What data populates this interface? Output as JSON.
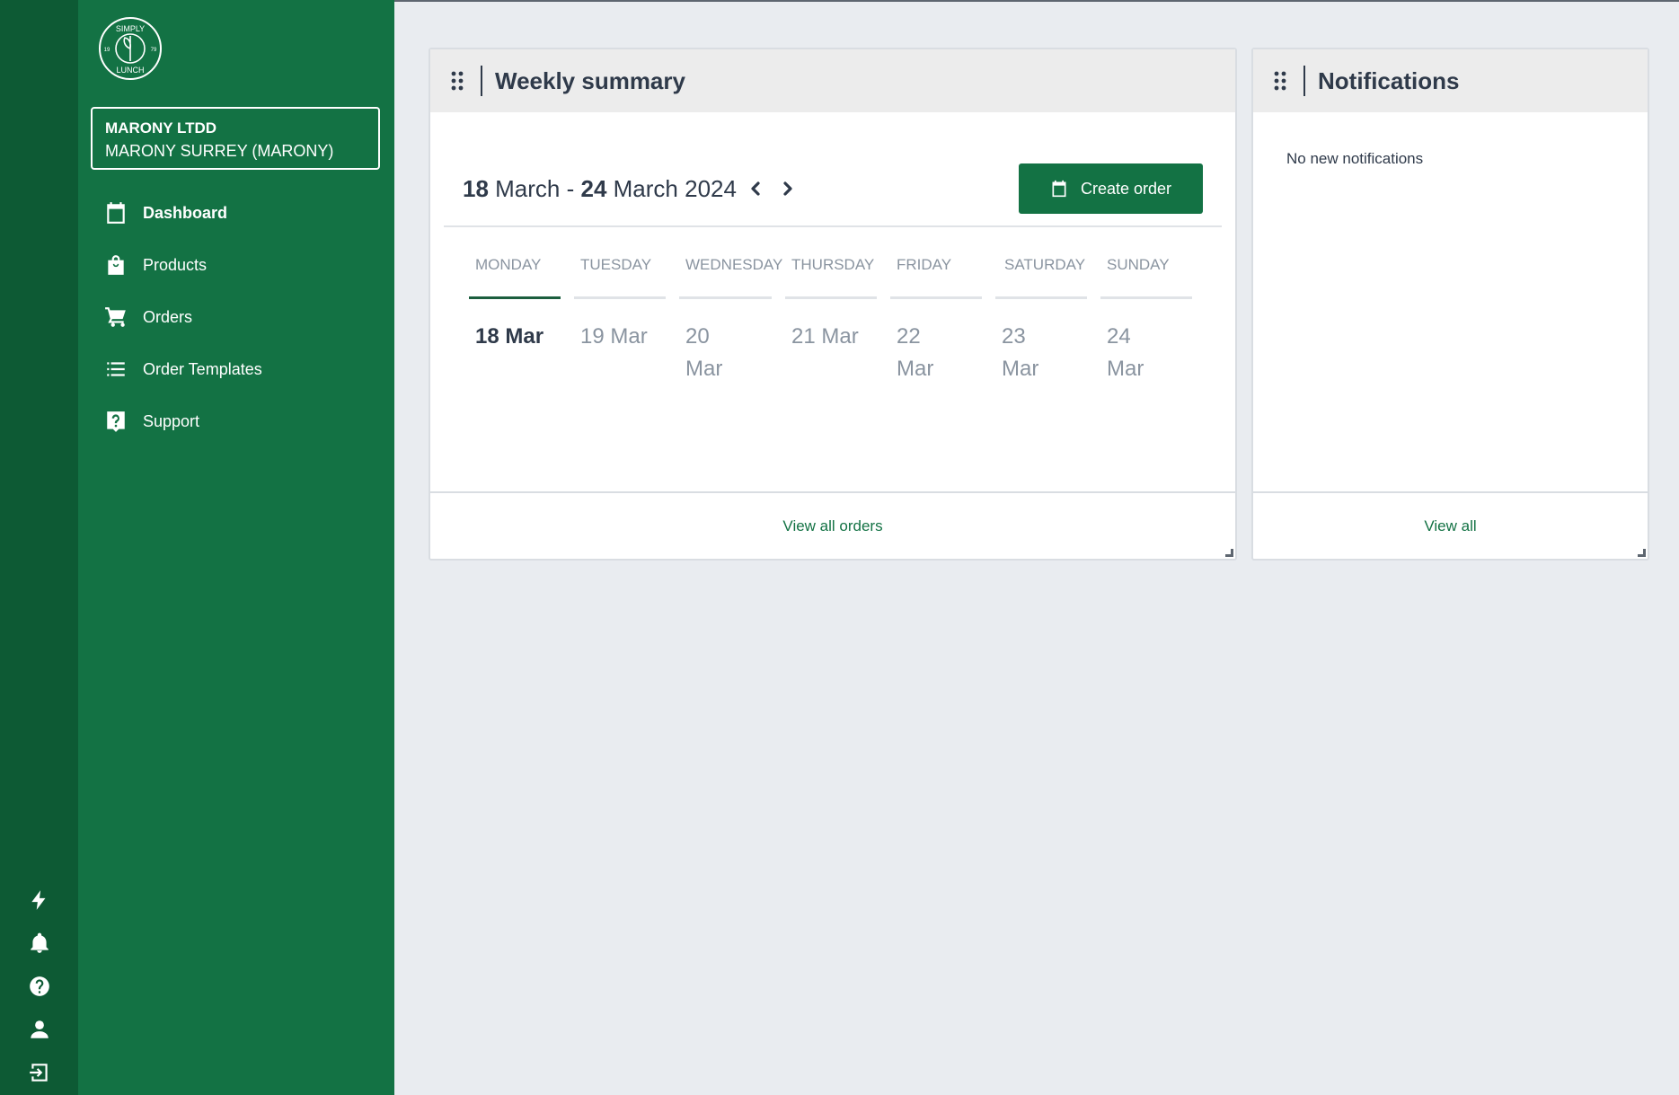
{
  "brand": {
    "logo_lines": [
      "SIMPLY",
      "LUNCH"
    ],
    "logo_year_left": "19",
    "logo_year_right": "79",
    "primary_color": "#137244",
    "rail_color": "#0d5a34"
  },
  "account": {
    "name": "MARONY LTDD",
    "site": "MARONY SURREY (MARONY)"
  },
  "nav": [
    {
      "label": "Dashboard",
      "icon": "calendar-icon",
      "active": true
    },
    {
      "label": "Products",
      "icon": "shopping-bag-icon",
      "active": false
    },
    {
      "label": "Orders",
      "icon": "cart-icon",
      "active": false
    },
    {
      "label": "Order Templates",
      "icon": "list-icon",
      "active": false
    },
    {
      "label": "Support",
      "icon": "help-chat-icon",
      "active": false
    }
  ],
  "rail_icons": [
    "lightning-icon",
    "bell-icon",
    "help-circle-icon",
    "user-icon",
    "logout-icon"
  ],
  "weekly": {
    "title": "Weekly summary",
    "range_start_day": "18",
    "range_start_rest": " March - ",
    "range_end_day": "24",
    "range_end_rest": " March 2024",
    "create_label": "Create order",
    "footer_link": "View all orders",
    "days": [
      {
        "name": "MONDAY",
        "date": "18 Mar",
        "active": true
      },
      {
        "name": "TUESDAY",
        "date": "19 Mar",
        "active": false
      },
      {
        "name": "WEDNESDAY",
        "date": "20 Mar",
        "active": false
      },
      {
        "name": "THURSDAY",
        "date": "21 Mar",
        "active": false
      },
      {
        "name": "FRIDAY",
        "date": "22 Mar",
        "active": false
      },
      {
        "name": "SATURDAY",
        "date": "23 Mar",
        "active": false
      },
      {
        "name": "SUNDAY",
        "date": "24 Mar",
        "active": false
      }
    ]
  },
  "notifications": {
    "title": "Notifications",
    "empty_text": "No new notifications",
    "footer_link": "View all"
  }
}
